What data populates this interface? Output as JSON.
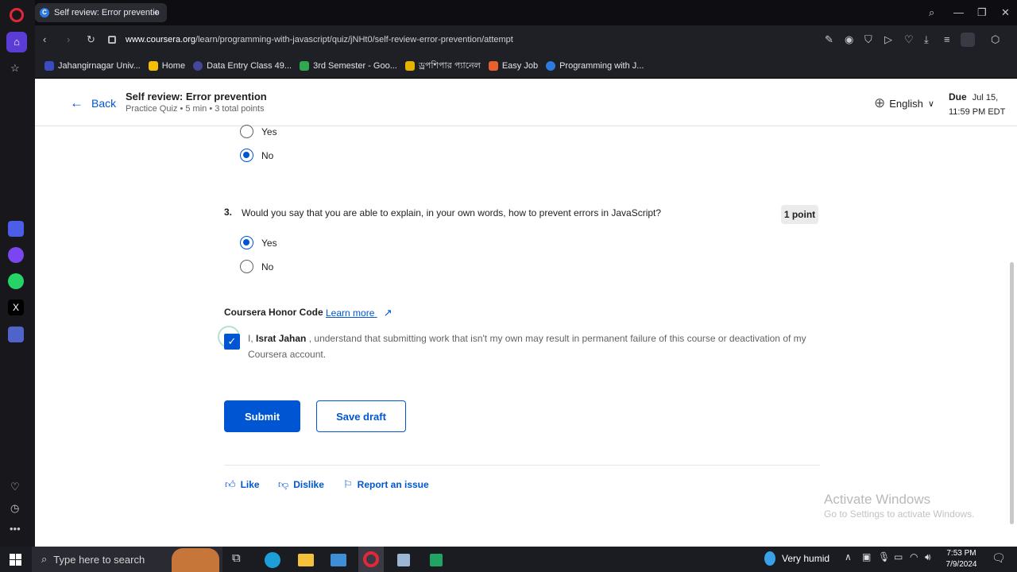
{
  "browser": {
    "tab_title": "Self review: Error preventio",
    "url_domain": "www.coursera.org",
    "url_path": "/learn/programming-with-javascript/quiz/jNHt0/self-review-error-prevention/attempt",
    "bookmarks": [
      "Jahangirnagar Univ...",
      "Home",
      "Data Entry Class 49...",
      "3rd Semester - Goo...",
      "ড্রপশিপার প্যানেল",
      "Easy Job",
      "Programming with J..."
    ]
  },
  "header": {
    "back_label": "Back",
    "title": "Self review: Error prevention",
    "subtitle": "Practice Quiz • 5 min • 3 total points",
    "language": "English",
    "due_label": "Due",
    "due_date": "Jul 15,",
    "due_time": "11:59 PM EDT"
  },
  "q2": {
    "options": [
      {
        "label": "Yes",
        "selected": false
      },
      {
        "label": "No",
        "selected": true
      }
    ]
  },
  "q3": {
    "number": "3.",
    "text": "Would you say that you are able to explain, in your own words, how to prevent errors in JavaScript?",
    "points": "1 point",
    "options": [
      {
        "label": "Yes",
        "selected": true
      },
      {
        "label": "No",
        "selected": false
      }
    ]
  },
  "honor": {
    "title": "Coursera Honor Code",
    "learn_more": "Learn more",
    "prefix": "I,",
    "name": "Israt Jahan",
    "statement": ", understand that submitting work that isn't my own may result in permanent failure of this course or deactivation of my Coursera account."
  },
  "actions": {
    "submit": "Submit",
    "save_draft": "Save draft"
  },
  "footer": {
    "like": "Like",
    "dislike": "Dislike",
    "report": "Report an issue"
  },
  "watermark": {
    "title": "Activate Windows",
    "sub": "Go to Settings to activate Windows."
  },
  "taskbar": {
    "search_placeholder": "Type here to search",
    "weather": "Very humid",
    "time": "7:53 PM",
    "date": "7/9/2024"
  },
  "colors": {
    "accent": "#0056d2"
  }
}
